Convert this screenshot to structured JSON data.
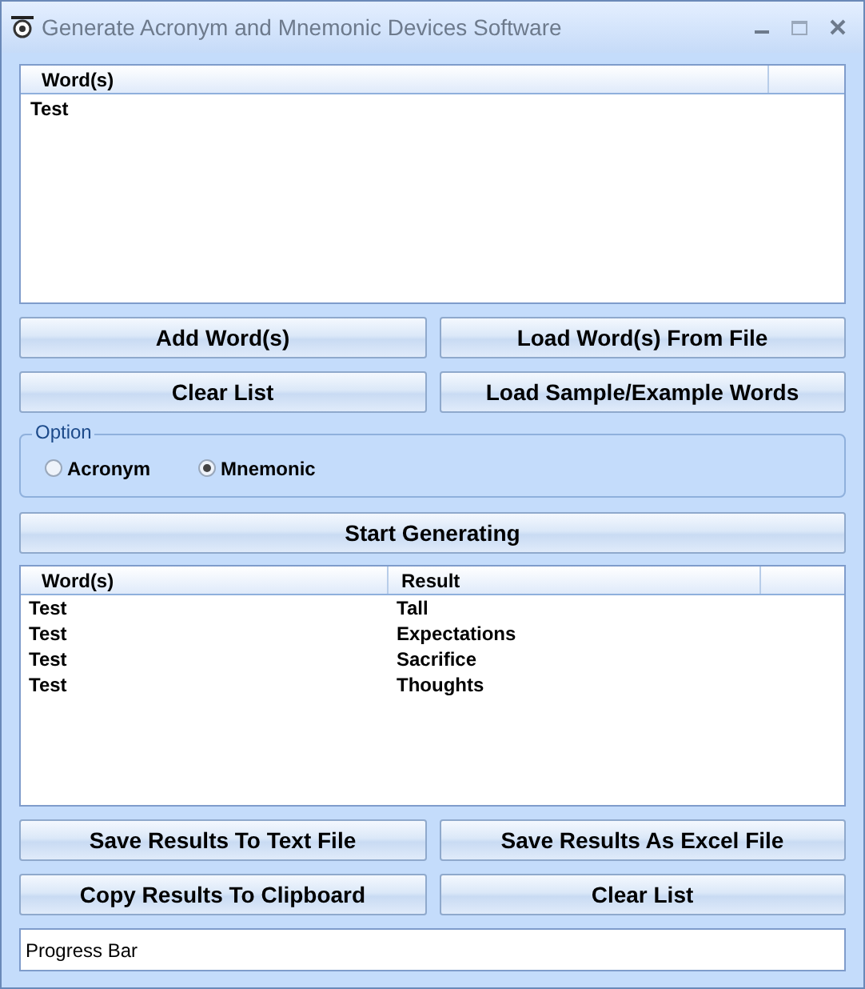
{
  "window": {
    "title": "Generate Acronym and Mnemonic Devices Software"
  },
  "words_list": {
    "columns": [
      "Word(s)"
    ],
    "rows": [
      "Test"
    ]
  },
  "buttons_top": [
    "Add Word(s)",
    "Load Word(s) From File",
    "Clear List",
    "Load Sample/Example Words"
  ],
  "option": {
    "label": "Option",
    "choices": [
      {
        "label": "Acronym",
        "selected": false
      },
      {
        "label": "Mnemonic",
        "selected": true
      }
    ]
  },
  "start_button": "Start Generating",
  "results": {
    "columns": [
      "Word(s)",
      "Result"
    ],
    "rows": [
      [
        "Test",
        "Tall"
      ],
      [
        "Test",
        "Expectations"
      ],
      [
        "Test",
        "Sacrifice"
      ],
      [
        "Test",
        "Thoughts"
      ]
    ]
  },
  "buttons_bottom": [
    "Save Results To Text File",
    "Save Results As Excel File",
    "Copy Results To Clipboard",
    "Clear List"
  ],
  "progress_bar": {
    "label": "Progress Bar"
  }
}
